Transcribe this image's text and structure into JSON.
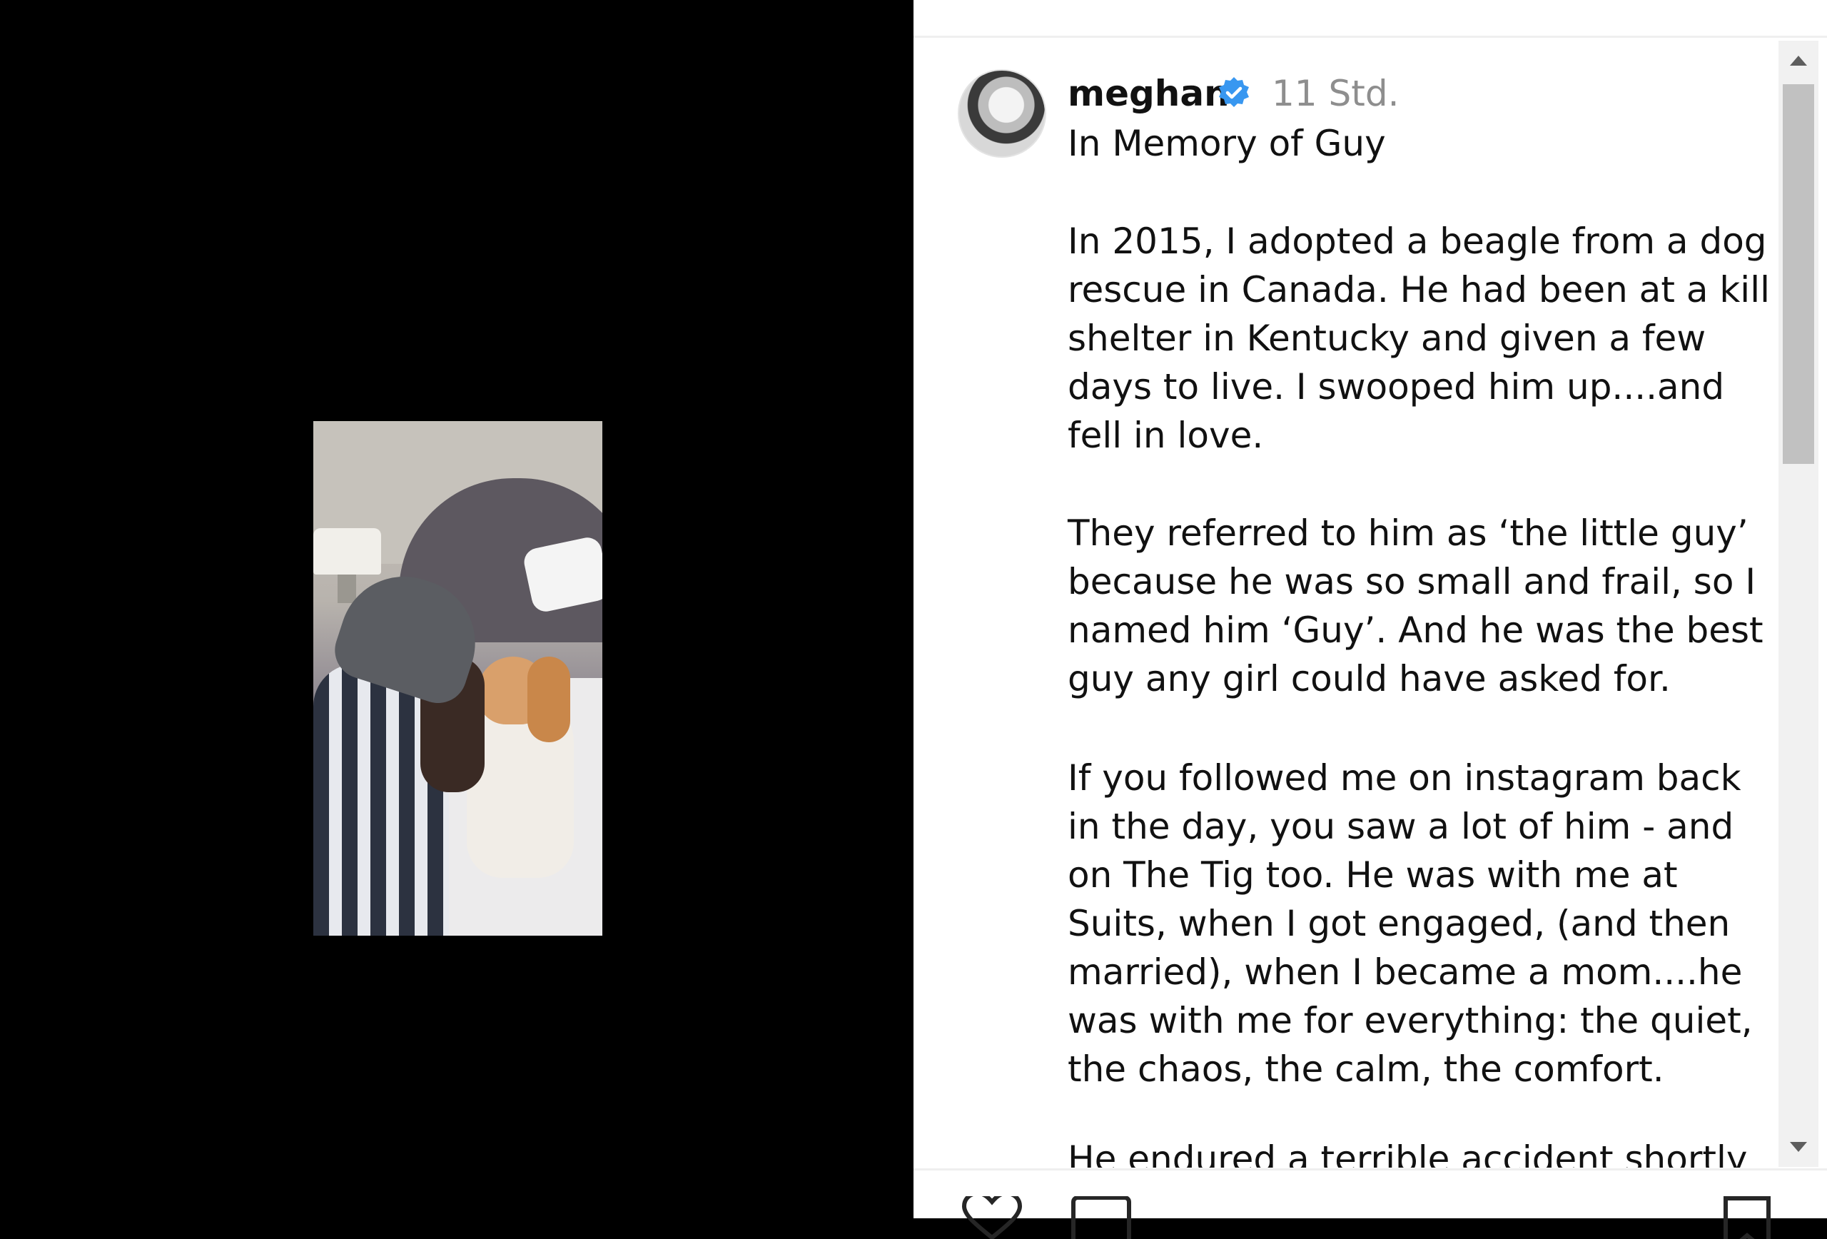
{
  "post": {
    "username": "meghan",
    "timestamp": "11 Std.",
    "title": "In Memory of Guy",
    "paragraphs": [
      "In 2015, I adopted a beagle from a dog\nrescue in Canada. He had been at a kill\nshelter in Kentucky and given a few\ndays to live. I swooped him up....and\nfell in love.",
      "They referred to him as ‘the little guy’\nbecause he was so small and frail, so I\nnamed him ‘Guy’. And he was the best\nguy any girl could have asked for.",
      "If you followed me on instagram back\nin the day, you saw a lot of him - and\non The Tig too. He was with me at\nSuits, when I got engaged, (and then\nmarried), when I became a mom....he\nwas with me for everything: the quiet,\nthe chaos, the calm, the comfort."
    ],
    "partial_line": "He endured a terrible accident shortly"
  },
  "icons": {
    "verified": "verified-badge-icon",
    "like": "heart-icon",
    "comment": "comment-icon",
    "save": "bookmark-icon",
    "scroll_up": "scroll-up-arrow-icon",
    "scroll_down": "scroll-down-arrow-icon"
  },
  "colors": {
    "verified_blue": "#3897f0",
    "text": "#111111",
    "muted": "#8e8e8e",
    "media_background": "#000000"
  }
}
